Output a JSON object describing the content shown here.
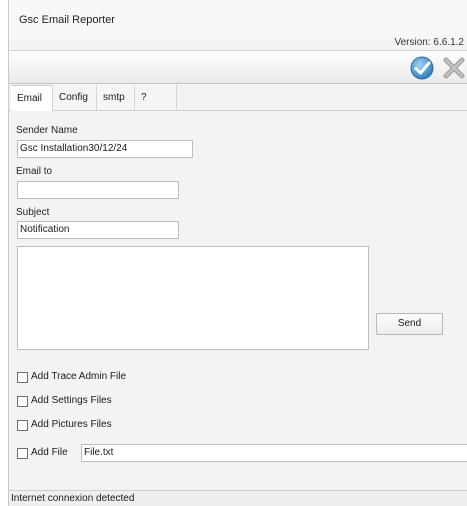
{
  "window": {
    "title": "Gsc Email Reporter",
    "version": "Version: 6.6.1.2"
  },
  "toolbar": {
    "ok_icon": "checkmark-icon",
    "close_icon": "close-icon",
    "ok_color": "#3b8fd0",
    "close_color": "#9a9a9a"
  },
  "tabs": [
    {
      "label": "Email",
      "active": true
    },
    {
      "label": "Config"
    },
    {
      "label": "smtp"
    },
    {
      "label": "?"
    }
  ],
  "form": {
    "sender_name_label": "Sender Name",
    "sender_name_value": "Gsc Installation30/12/24",
    "email_to_label": "Email to",
    "email_to_value": "",
    "subject_label": "Subject",
    "subject_value": "Notification",
    "message_value": "",
    "send_label": "Send"
  },
  "checkboxes": [
    {
      "label": "Add Trace Admin File",
      "checked": false
    },
    {
      "label": "Add Settings Files",
      "checked": false
    },
    {
      "label": "Add Pictures Files",
      "checked": false
    },
    {
      "label": "Add File",
      "checked": false
    }
  ],
  "add_file_value": "File.txt",
  "status": {
    "text": "Internet connexion detected"
  }
}
